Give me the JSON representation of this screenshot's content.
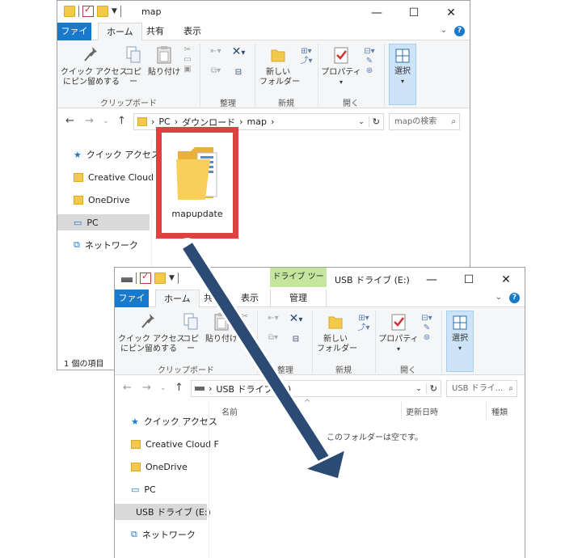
{
  "win1": {
    "title": "map",
    "tabs": [
      "ファイル",
      "ホーム",
      "共有",
      "表示"
    ],
    "ribbon": {
      "pin": "クイック アクセス\nにピン留めする",
      "copy": "コピー",
      "paste": "貼り付け",
      "new_folder": "新しい\nフォルダー",
      "properties": "プロパティ",
      "select": "選択",
      "groups": [
        "クリップボード",
        "整理",
        "新規",
        "開く"
      ]
    },
    "breadcrumb": [
      "PC",
      "ダウンロード",
      "map"
    ],
    "search_placeholder": "mapの検索",
    "sidebar": [
      "クイック アクセス",
      "Creative Cloud F",
      "OneDrive",
      "PC",
      "ネットワーク"
    ],
    "folder_name": "mapupdate",
    "status": "1 個の項目"
  },
  "win2": {
    "title": "USB ドライブ (E:)",
    "context_tab": "ドライブ ツール",
    "context_subtab": "管理",
    "tabs": [
      "ファイル",
      "ホーム",
      "共有",
      "表示"
    ],
    "ribbon": {
      "pin": "クイック アクセス\nにピン留めする",
      "copy": "コピー",
      "paste": "貼り付け",
      "new_folder": "新しい\nフォルダー",
      "properties": "プロパティ",
      "select": "選択",
      "groups": [
        "クリップボード",
        "整理",
        "新規",
        "開く"
      ]
    },
    "breadcrumb": [
      "USB ドライブ (E:)"
    ],
    "search_placeholder": "USB ドライ...",
    "columns": [
      "名前",
      "更新日時",
      "種類"
    ],
    "empty_message": "このフォルダーは空です。",
    "sidebar": [
      "クイック アクセス",
      "Creative Cloud F",
      "OneDrive",
      "PC",
      "USB ドライブ (E:)",
      "ネットワーク"
    ]
  },
  "colors": {
    "file_tab": "#1979ca",
    "highlight": "#e04040",
    "arrow": "#2b4a74",
    "context": "#c6e6a0"
  }
}
